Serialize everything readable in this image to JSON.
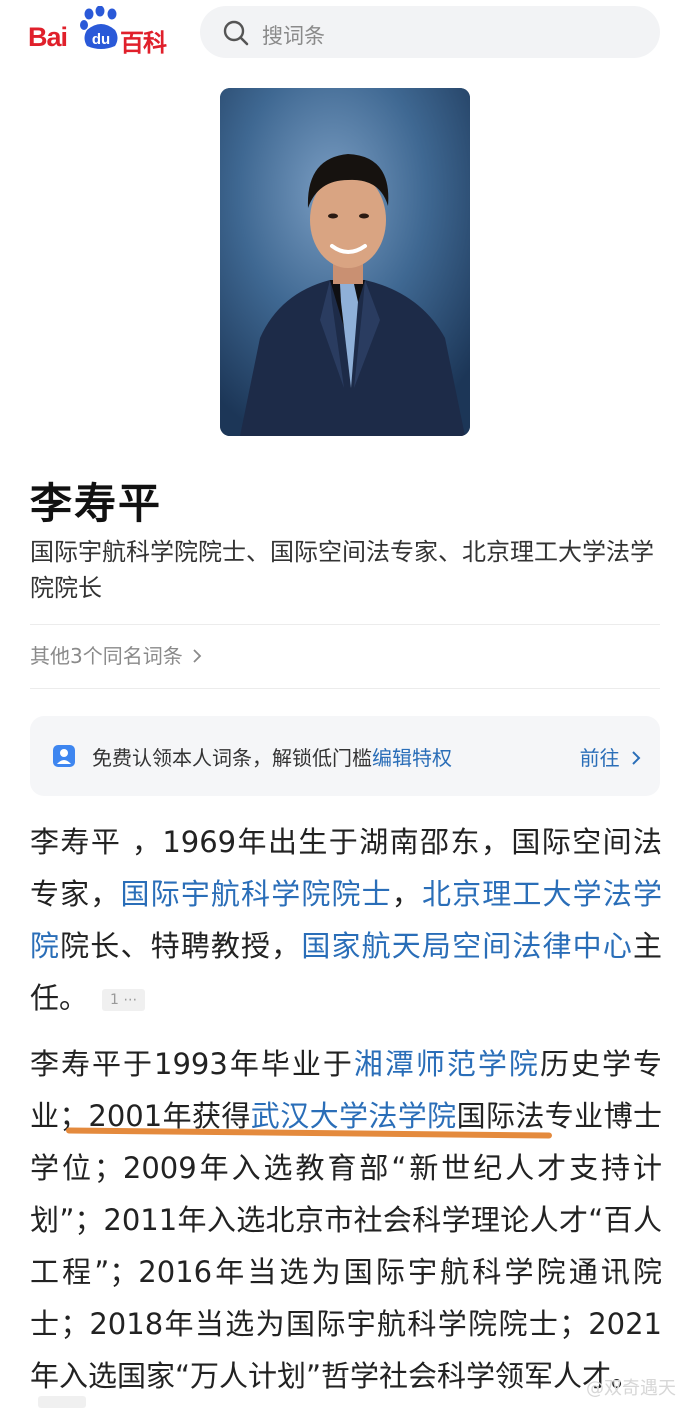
{
  "header": {
    "logo_bai": "Bai",
    "logo_du": "du",
    "logo_baike": "百科",
    "search_placeholder": "搜词条"
  },
  "person": {
    "name": "李寿平",
    "summary": "国际宇航科学院院士、国际空间法专家、北京理工大学法学院院长",
    "other_entries": "其他3个同名词条"
  },
  "claim": {
    "text": "免费认领本人词条，解锁低门槛",
    "link": "编辑特权",
    "go": "前往"
  },
  "para1": {
    "t1": "李寿平 ，1969年出生于湖南邵东，国际空间法专家，",
    "l1": "国际宇航科学院院士",
    "t2": "，",
    "l2": "北京理工大学法学院",
    "t3": "院长、特聘教授，",
    "l3": "国家航天局空间法律中心",
    "t4": "主任。",
    "cite": "1"
  },
  "para2": {
    "t1": "李寿平于1993年毕业于",
    "l1": "湘潭师范学院",
    "t2": "历史学专业；2001年获得",
    "l2": "武汉大学法学院",
    "t3": "国际法专业博士学位；2009年入选教育部“新世纪人才支持计划”；2011年入选北京市社会科学理论人才“百人工程”；2016年当选为国际宇航科学院通讯院士；2018年当选为国际宇航科学院院士；2021年入选国家“万人计划”哲学社会科学领军人才。"
  },
  "watermark": "@双奇遇天",
  "colors": {
    "brand_red": "#e0202b",
    "brand_blue": "#2a59d8",
    "link_blue": "#2a6eb8",
    "highlight_orange": "#e48a3d"
  },
  "icons": [
    "paw-logo-icon",
    "search-icon",
    "user-badge-icon",
    "chevron-right-icon"
  ]
}
